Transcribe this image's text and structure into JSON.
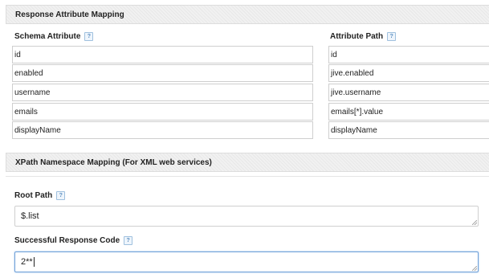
{
  "response_mapping": {
    "title": "Response Attribute Mapping",
    "schema_header": "Schema Attribute",
    "path_header": "Attribute Path",
    "help_glyph": "?",
    "rows": [
      {
        "schema": "id",
        "path": "id"
      },
      {
        "schema": "enabled",
        "path": "jive.enabled"
      },
      {
        "schema": "username",
        "path": "jive.username"
      },
      {
        "schema": "emails",
        "path": "emails[*].value"
      },
      {
        "schema": "displayName",
        "path": "displayName"
      }
    ]
  },
  "xpath": {
    "title": "XPath Namespace Mapping (For XML web services)"
  },
  "root_path": {
    "label": "Root Path",
    "value": "$.list"
  },
  "response_code": {
    "label": "Successful Response Code",
    "value": "2**"
  },
  "colors": {
    "help_icon": "#5a8dc0",
    "focus_border": "#6ea0d8"
  },
  "icons": {
    "help": "help-icon",
    "resize": "resize-grip-icon"
  }
}
